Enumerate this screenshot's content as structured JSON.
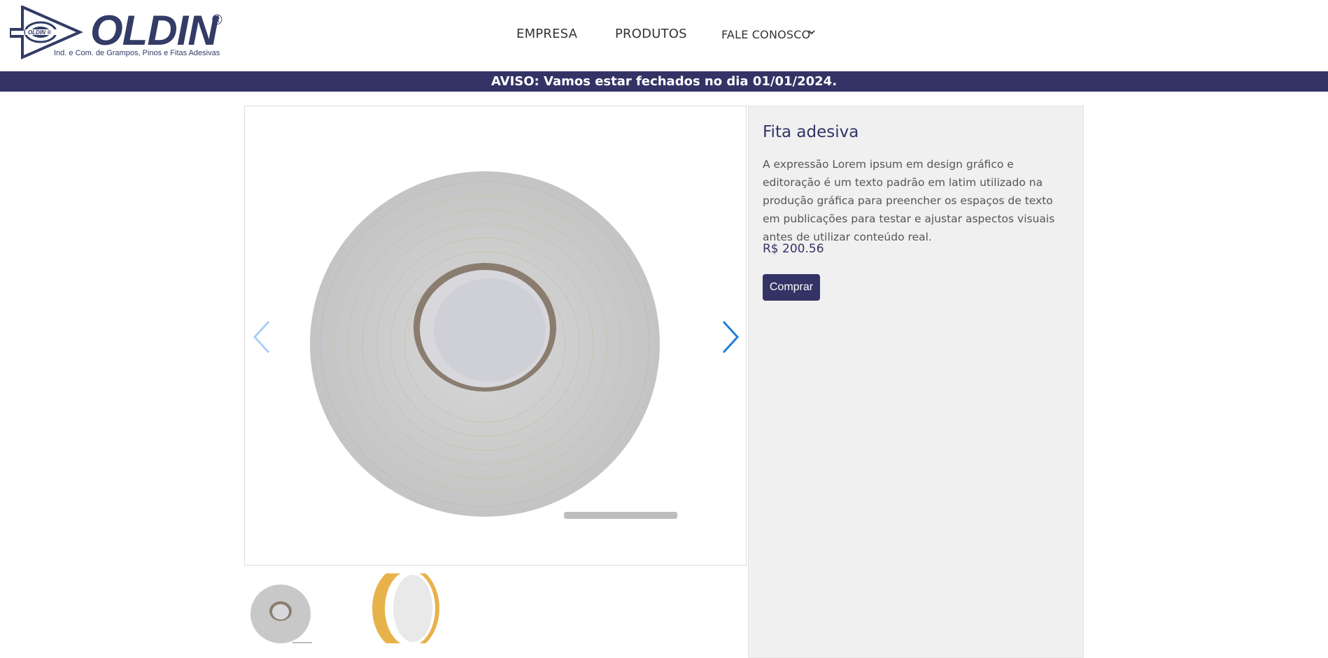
{
  "brand": {
    "name": "OLDIN",
    "registered": "®",
    "tagline": "Ind. e Com. de Grampos, Pinos e Fitas Adesivas",
    "emblem_text": "OLDIN ®"
  },
  "nav": {
    "items": [
      {
        "label": "EMPRESA"
      },
      {
        "label": "PRODUTOS"
      },
      {
        "label": "FALE CONOSCO"
      }
    ]
  },
  "notice": {
    "text": "AVISO: Vamos estar fechados no dia 01/01/2024."
  },
  "gallery": {
    "thumbnails_count": 2,
    "prev_icon": "chevron-left-icon",
    "next_icon": "chevron-right-icon"
  },
  "product": {
    "title": "Fita adesiva",
    "description": "A expressão Lorem ipsum em design gráfico e editoração é um texto padrão em latim utilizado na produção gráfica para preencher os espaços de texto em publicações para testar e ajustar aspectos visuais antes de utilizar conteúdo real.",
    "price": "R$ 200.56",
    "buy_label": "Comprar"
  },
  "colors": {
    "brand_navy": "#333366",
    "accent_blue": "#1f7fd6",
    "panel_bg": "#f0f0f0"
  }
}
